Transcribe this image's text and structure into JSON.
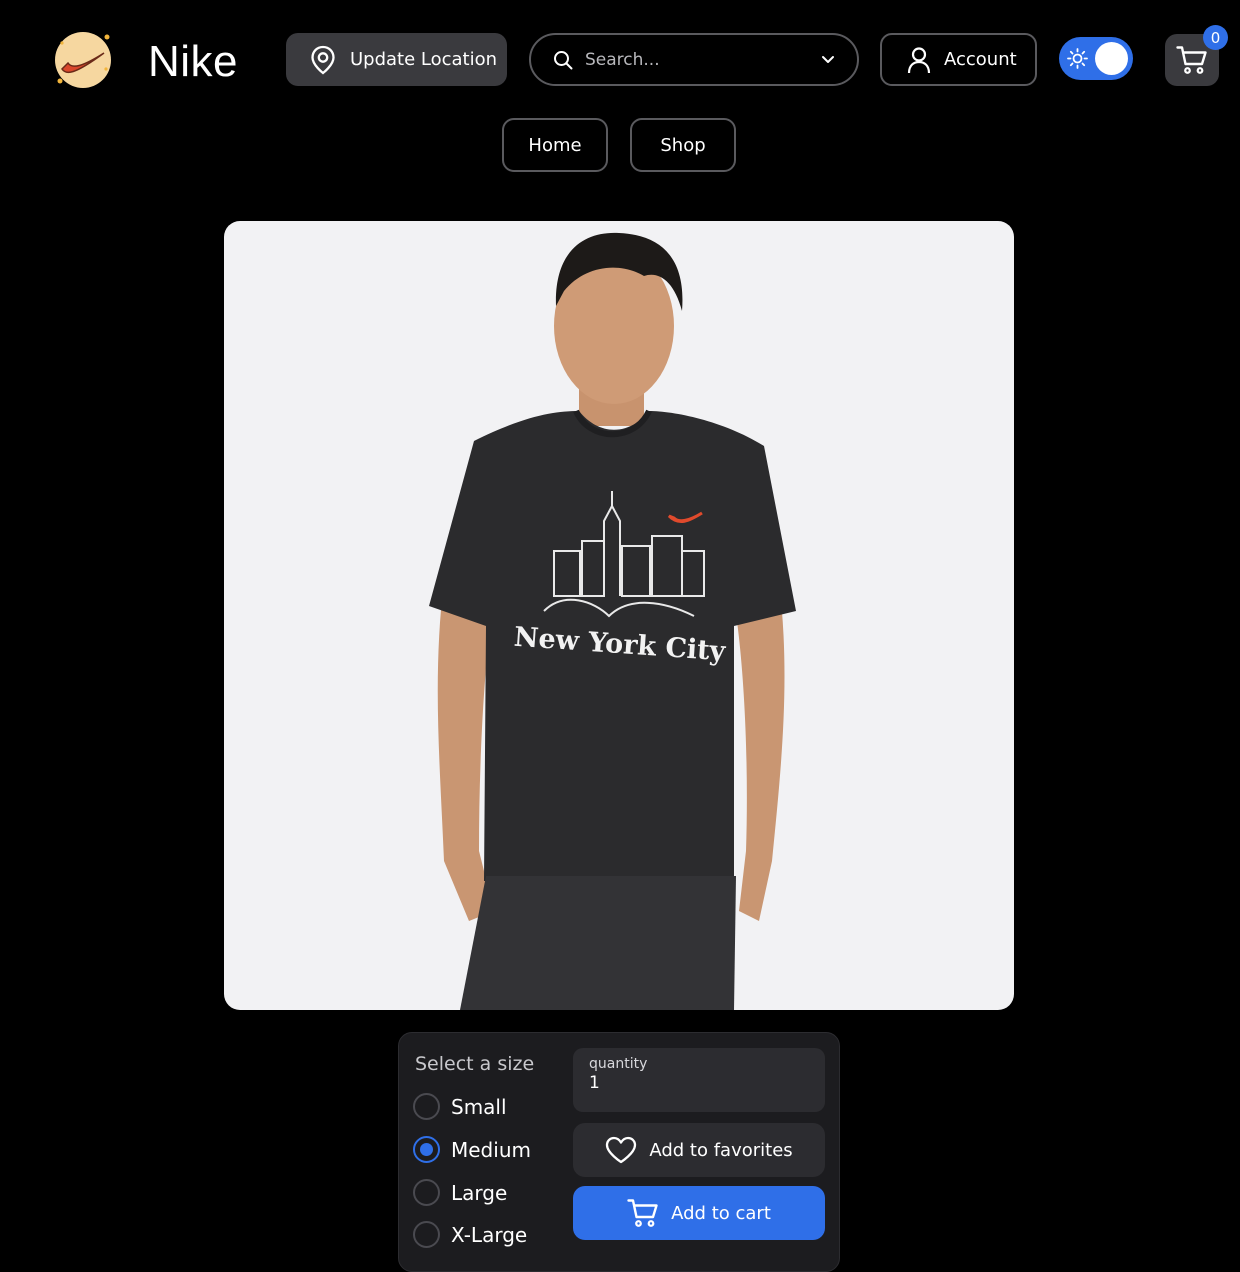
{
  "header": {
    "logo_icon": "nike-swoosh-logo-icon",
    "brand": "Nike",
    "location_button_label": "Update Location",
    "search_placeholder": "Search...",
    "account_label": "Account",
    "theme_toggle": {
      "state": "on",
      "icon": "sun-icon"
    },
    "cart_count": "0"
  },
  "nav": {
    "items": [
      {
        "label": "Home"
      },
      {
        "label": "Shop"
      }
    ]
  },
  "product": {
    "image_description": "model-wearing-black-tshirt",
    "shirt_print": "New York City"
  },
  "purchase": {
    "size_title": "Select a size",
    "sizes": [
      {
        "label": "Small",
        "selected": false
      },
      {
        "label": "Medium",
        "selected": true
      },
      {
        "label": "Large",
        "selected": false
      },
      {
        "label": "X-Large",
        "selected": false
      }
    ],
    "quantity_label": "quantity",
    "quantity_value": "1",
    "favorites_label": "Add to favorites",
    "cart_label": "Add to cart"
  },
  "colors": {
    "accent": "#2f6fe8",
    "background": "#000000",
    "panel": "#1c1c1f",
    "image_bg": "#f2f2f4"
  }
}
